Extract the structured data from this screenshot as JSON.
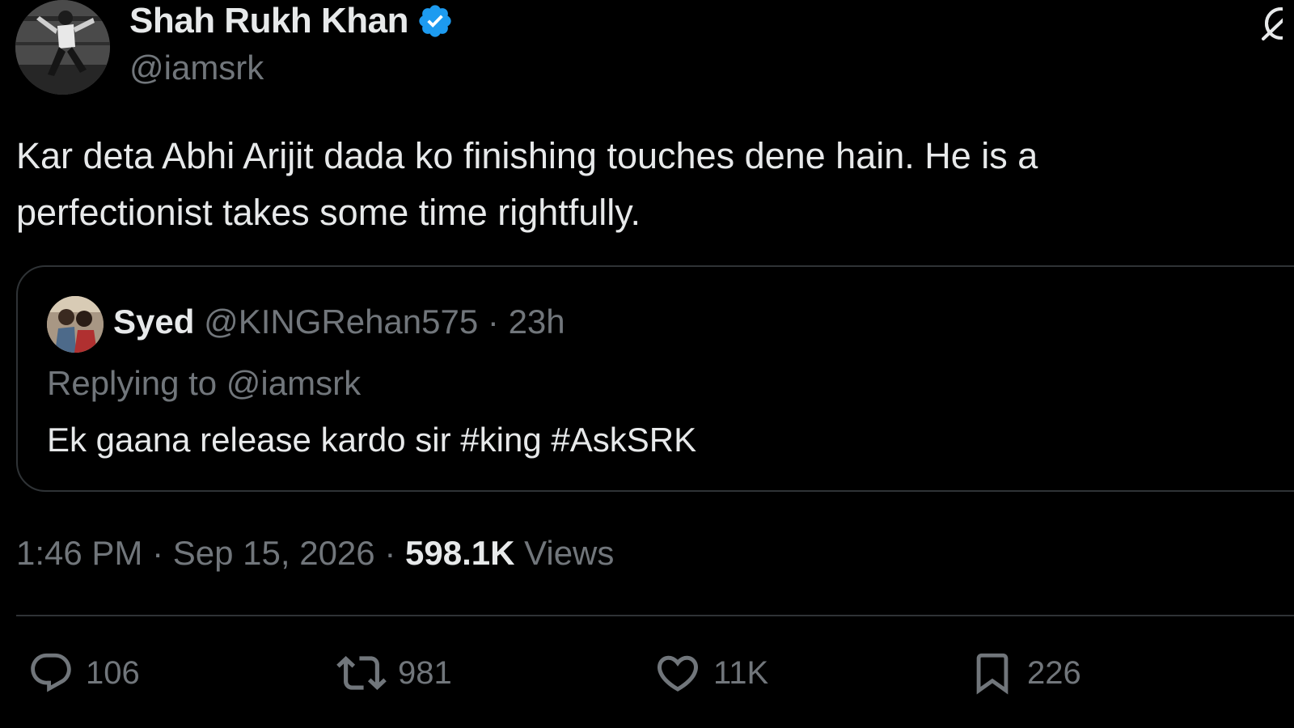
{
  "author": {
    "name": "Shah Rukh Khan",
    "handle": "@iamsrk",
    "verified": true,
    "verified_color": "#1d9bf0"
  },
  "tweet": {
    "text": "Kar deta Abhi Arijit dada ko finishing touches dene hain. He is a\nperfectionist takes some time rightfully."
  },
  "quoted": {
    "name": "Syed",
    "handle": "@KINGRehan575",
    "separator": "·",
    "time": "23h",
    "replying_to": "Replying to @iamsrk",
    "text": "Ek gaana release kardo sir #king #AskSRK"
  },
  "meta": {
    "time": "1:46 PM",
    "separator": "·",
    "date": "Sep 15, 2026",
    "views_count": "598.1K",
    "views_label": "Views"
  },
  "actions": {
    "replies": "106",
    "retweets": "981",
    "likes": "11K",
    "bookmarks": "226"
  },
  "icons": {
    "reply": "speech-bubble-icon",
    "retweet": "retweet-arrows-icon",
    "like": "heart-icon",
    "bookmark": "bookmark-icon",
    "grok": "grok-icon",
    "verified": "verified-badge-icon"
  },
  "colors": {
    "background": "#000000",
    "text_primary": "#e7e9ea",
    "text_secondary": "#71767b",
    "border": "#2f3336"
  }
}
